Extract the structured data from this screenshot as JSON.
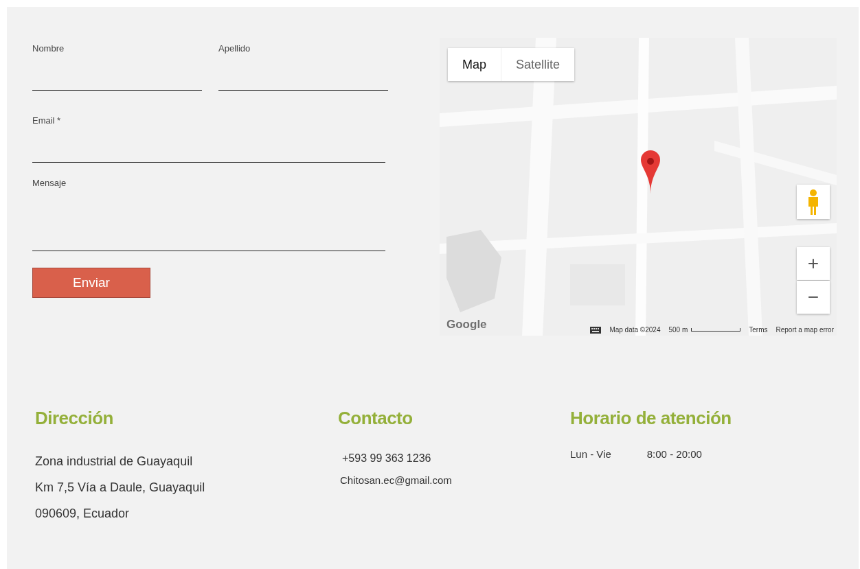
{
  "form": {
    "fields": [
      {
        "label": "Nombre",
        "kind": "line"
      },
      {
        "label": "Apellido",
        "kind": "line"
      },
      {
        "label": "Email *",
        "kind": "line"
      },
      {
        "label": "Mensaje",
        "kind": "area"
      }
    ],
    "submit": "Enviar"
  },
  "map": {
    "map_types": [
      {
        "label": "Map",
        "selected": true
      },
      {
        "label": "Satellite",
        "selected": false
      }
    ],
    "zoom_in": "+",
    "zoom_out": "−",
    "logo": "Google",
    "attribution": "Map data ©2024",
    "scale": "500 m",
    "terms": "Terms",
    "report": "Report a map error"
  },
  "footer": {
    "address": {
      "title": "Dirección",
      "lines": [
        "Zona industrial de Guayaquil",
        "Km 7,5 Vía a Daule, Guayaquil",
        "090609, Ecuador"
      ]
    },
    "contact": {
      "title": "Contacto",
      "phone": "+593 99 363 1236",
      "email": "Chitosan.ec@gmail.com"
    },
    "hours": {
      "title": "Horario de atención",
      "rows": [
        {
          "days": "Lun - Vie",
          "time": "8:00 - 20:00"
        }
      ]
    }
  }
}
